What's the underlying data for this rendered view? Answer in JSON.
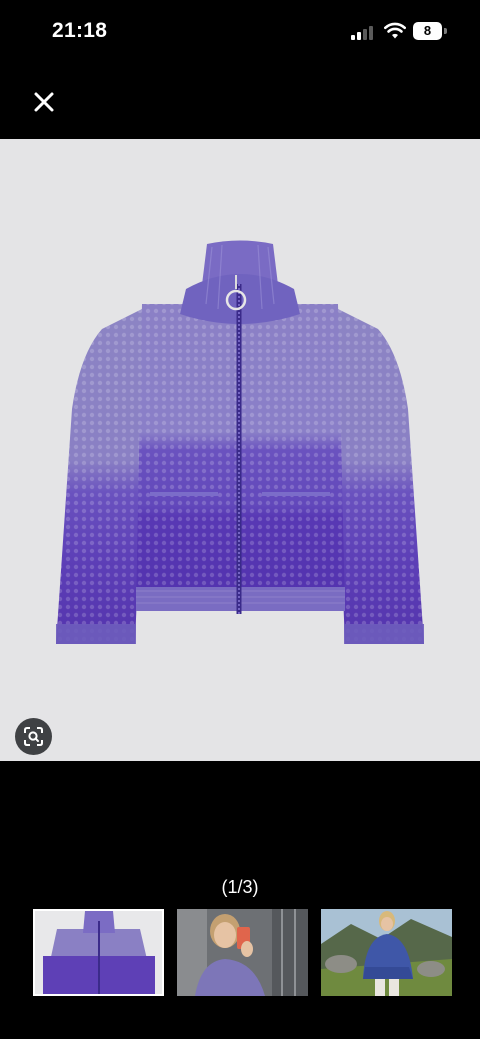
{
  "status_bar": {
    "time": "21:18",
    "battery_level": "8",
    "icons": [
      "signal-icon",
      "wifi-icon",
      "battery-icon"
    ]
  },
  "viewer": {
    "close_icon": "close-icon",
    "lens_icon": "visual-search-icon",
    "pager_text": "(1/3)",
    "current_index": 1,
    "total_images": 3
  },
  "thumbnails": [
    {
      "name": "thumbnail-product",
      "selected": true
    },
    {
      "name": "thumbnail-mirror-selfie",
      "selected": false
    },
    {
      "name": "thumbnail-outdoor",
      "selected": false
    }
  ],
  "colors": {
    "background": "#000000",
    "image_background": "#e4e4e6",
    "sweater_light": "#8b80c6",
    "sweater_dark": "#5c3fb5"
  }
}
